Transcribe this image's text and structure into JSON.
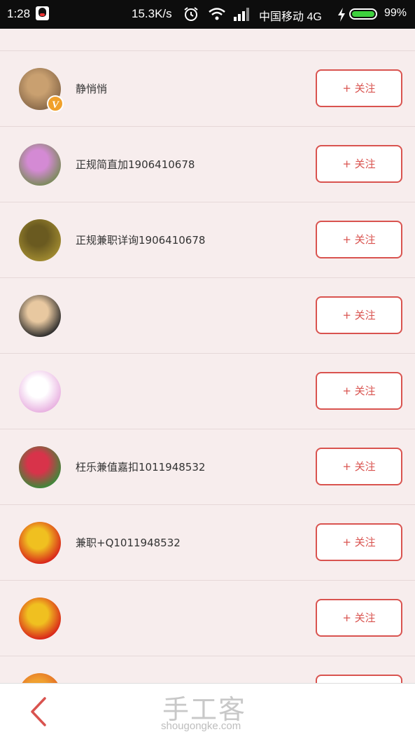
{
  "status_bar": {
    "time": "1:28",
    "speed": "15.3K/s",
    "carrier": "中国移动 4G",
    "battery": "99%",
    "icons": [
      "qq-icon",
      "alarm-icon",
      "wifi-icon",
      "signal-icon",
      "charging-icon",
      "battery-icon"
    ]
  },
  "follow_label": "+ 关注",
  "users": [
    {
      "name": "静悄悄",
      "verified": true,
      "badge": "V",
      "avatar_colors": [
        "#8a6a4a",
        "#c9a070"
      ]
    },
    {
      "name": "正规简直加1906410678",
      "verified": false,
      "avatar_colors": [
        "#7a8a5a",
        "#d48ad4"
      ]
    },
    {
      "name": "正规兼职详询1906410678",
      "verified": false,
      "avatar_colors": [
        "#a08a30",
        "#6a5a20"
      ]
    },
    {
      "name": "",
      "verified": false,
      "avatar_colors": [
        "#2a2a2a",
        "#e8c8a0"
      ]
    },
    {
      "name": "",
      "verified": false,
      "avatar_colors": [
        "#e8b0e0",
        "#ffffff"
      ]
    },
    {
      "name": "枉乐兼值嘉扣1011948532",
      "verified": false,
      "avatar_colors": [
        "#3a8a3a",
        "#d8334a"
      ]
    },
    {
      "name": "兼职+Q1011948532",
      "verified": false,
      "avatar_colors": [
        "#d8201a",
        "#f0c020"
      ]
    },
    {
      "name": "",
      "verified": false,
      "avatar_colors": [
        "#d8201a",
        "#f0c020"
      ]
    },
    {
      "name": "",
      "verified": false,
      "avatar_colors": [
        "#e06020",
        "#f0a030"
      ]
    }
  ],
  "bottom_bar": {
    "logo_cn": "手工客",
    "logo_en": "shougongke.com",
    "back_icon": "chevron-left-icon"
  },
  "colors": {
    "accent": "#d9534f",
    "background": "#f7eded"
  }
}
